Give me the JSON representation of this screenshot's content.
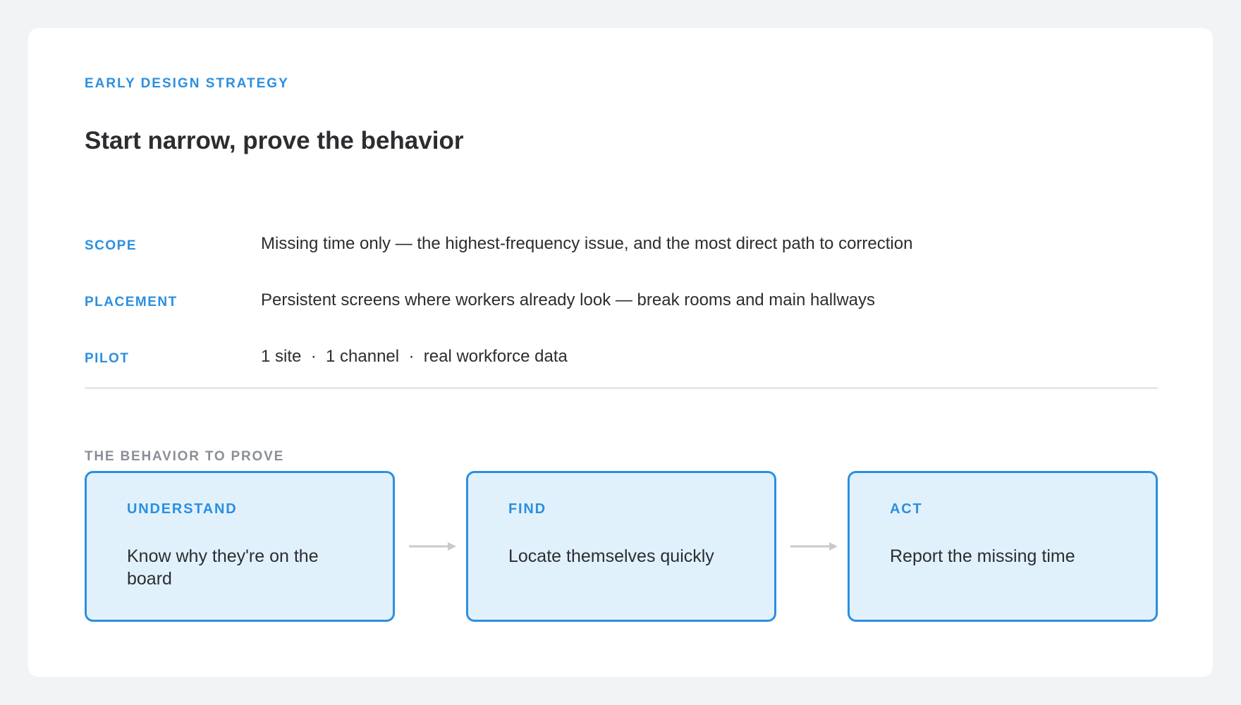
{
  "header": {
    "eyebrow": "EARLY DESIGN STRATEGY",
    "title": "Start narrow, prove the behavior"
  },
  "details": [
    {
      "label": "SCOPE",
      "value": "Missing time only — the highest-frequency issue, and the most direct path to correction"
    },
    {
      "label": "PLACEMENT",
      "value": "Persistent screens where workers already look — break rooms and main hallways"
    },
    {
      "label": "PILOT",
      "value": "1 site  ·  1 channel  ·  real workforce data"
    }
  ],
  "behavior": {
    "section_title": "THE BEHAVIOR TO PROVE",
    "steps": [
      {
        "label": "UNDERSTAND",
        "text": "Know why they're on the board"
      },
      {
        "label": "FIND",
        "text": "Locate themselves quickly"
      },
      {
        "label": "ACT",
        "text": "Report the missing time"
      }
    ]
  },
  "colors": {
    "accent": "#2b8fe0",
    "step_fill": "#e1f1fc",
    "arrow": "#c7cacf",
    "muted": "#8a8e96",
    "text": "#2b2d31"
  }
}
